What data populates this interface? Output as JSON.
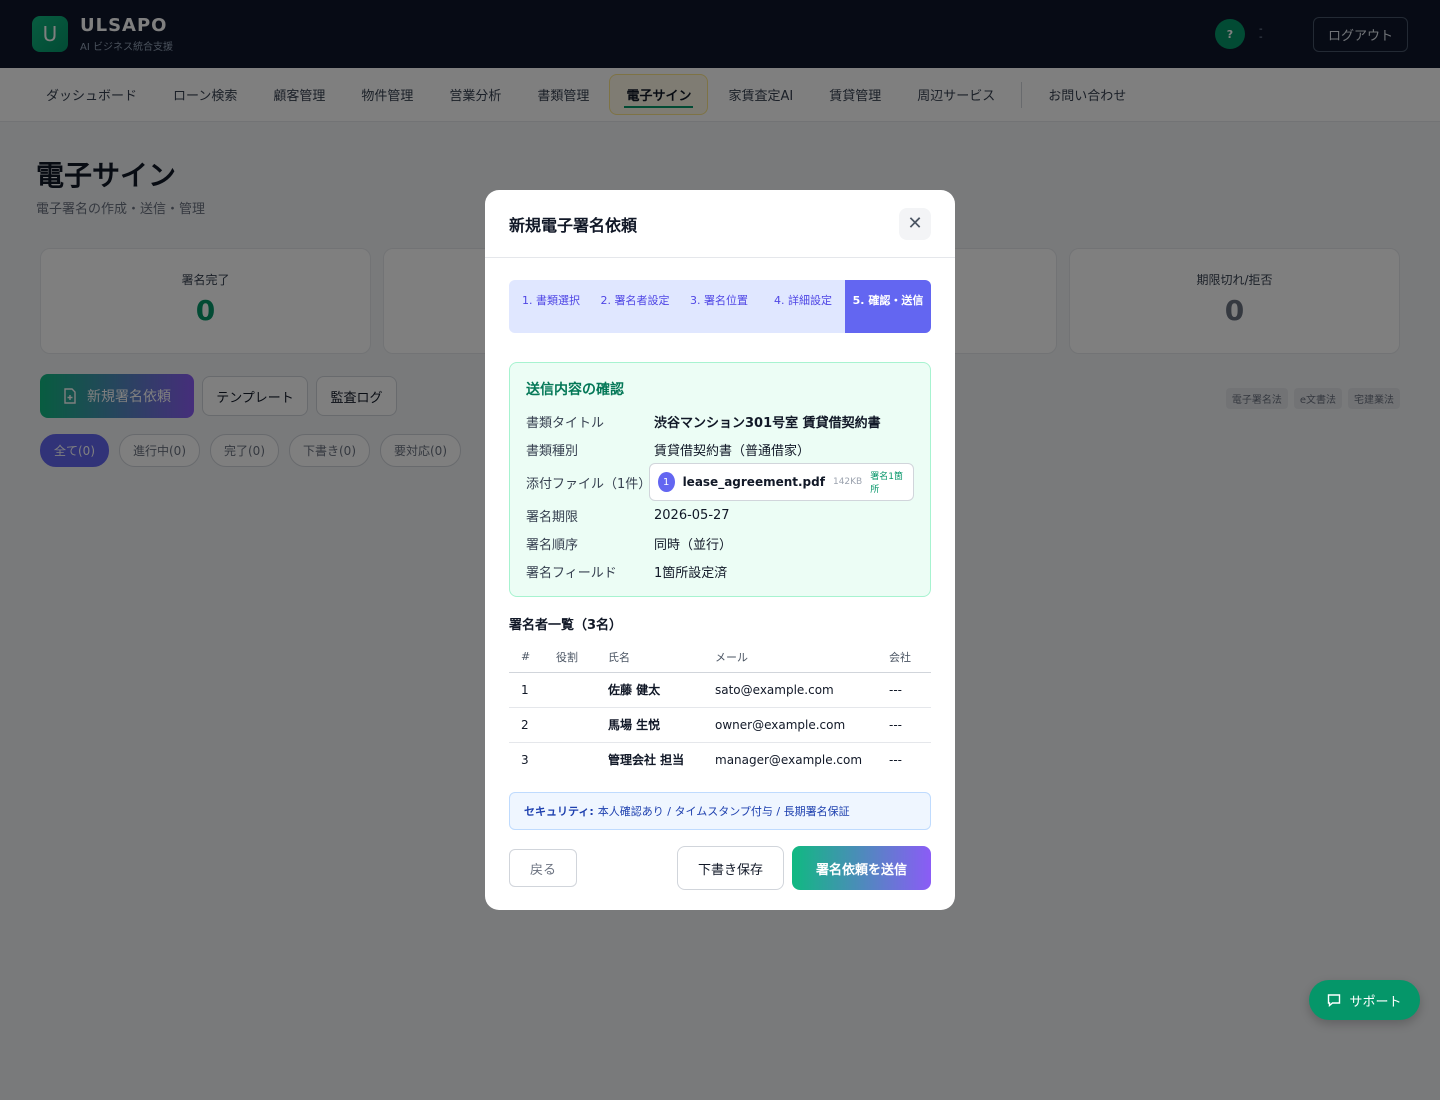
{
  "app": {
    "logo_letter": "U",
    "name": "ULSAPO",
    "subtitle": "AI ビジネス統合支援",
    "help_label": "?",
    "user_line1": "-",
    "user_line2": "-",
    "logout_label": "ログアウト"
  },
  "nav": {
    "items": [
      {
        "label": "ダッシュボード"
      },
      {
        "label": "ローン検索"
      },
      {
        "label": "顧客管理"
      },
      {
        "label": "物件管理"
      },
      {
        "label": "営業分析"
      },
      {
        "label": "書類管理"
      },
      {
        "label": "電子サイン",
        "active": true
      },
      {
        "label": "家賃査定AI"
      },
      {
        "label": "賃貸管理"
      },
      {
        "label": "周辺サービス"
      },
      {
        "label": "お問い合わせ"
      }
    ]
  },
  "page": {
    "title": "電子サイン",
    "subtitle": "電子署名の作成・送信・管理"
  },
  "stats": [
    {
      "label": "署名完了",
      "value": "0",
      "color": "#059669"
    },
    {
      "label": "",
      "value": "",
      "color": "#6b7280"
    },
    {
      "label": "",
      "value": "",
      "color": "#6b7280"
    },
    {
      "label": "期限切れ/拒否",
      "value": "0",
      "color": "#6b7280"
    }
  ],
  "actions": {
    "new_request": "新規署名依頼",
    "templates": "テンプレート",
    "audit_log": "監査ログ"
  },
  "law_tags": [
    "電子署名法",
    "e文書法",
    "宅建業法"
  ],
  "filters": [
    "全て(0)",
    "進行中(0)",
    "完了(0)",
    "下書き(0)",
    "要対応(0)"
  ],
  "support_label": "サポート",
  "modal": {
    "title": "新規電子署名依頼",
    "close_symbol": "✕",
    "steps": [
      "1. 書類選択",
      "2. 署名者設定",
      "3. 署名位置",
      "4. 詳細設定",
      "5. 確認・送信"
    ],
    "active_step": 4,
    "confirm": {
      "title": "送信内容の確認",
      "doc_title_key": "書類タイトル",
      "doc_title_val": "渋谷マンション301号室 賃貸借契約書",
      "doc_type_key": "書類種別",
      "doc_type_val": "賃貸借契約書（普通借家）",
      "attach_key": "添付ファイル（1件）",
      "file": {
        "num": "1",
        "name": "lease_agreement.pdf",
        "size": "142KB",
        "sign": "署名1箇所"
      },
      "deadline_key": "署名期限",
      "deadline_val": "2026-05-27",
      "order_key": "署名順序",
      "order_val": "同時（並行）",
      "field_key": "署名フィールド",
      "field_val": "1箇所設定済"
    },
    "signers_title": "署名者一覧（3名）",
    "signers_headers": [
      "#",
      "役割",
      "氏名",
      "メール",
      "会社"
    ],
    "signers": [
      {
        "num": "1",
        "role": "",
        "name": "佐藤 健太",
        "email": "sato@example.com",
        "company": "---"
      },
      {
        "num": "2",
        "role": "",
        "name": "馬場 生悦",
        "email": "owner@example.com",
        "company": "---"
      },
      {
        "num": "3",
        "role": "",
        "name": "管理会社 担当",
        "email": "manager@example.com",
        "company": "---"
      }
    ],
    "security_label": "セキュリティ:",
    "security_text": "本人確認あり / タイムスタンプ付与 / 長期署名保証",
    "back_label": "戻る",
    "draft_label": "下書き保存",
    "send_label": "署名依頼を送信"
  }
}
